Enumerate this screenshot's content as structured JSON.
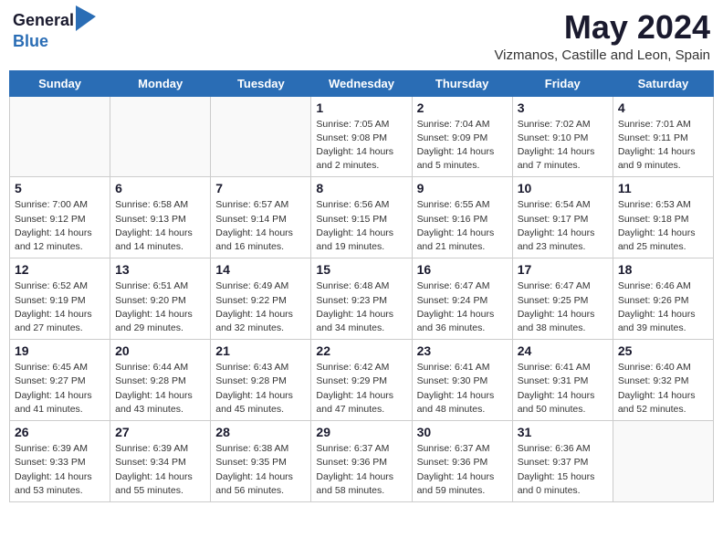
{
  "header": {
    "logo_line1": "General",
    "logo_line2": "Blue",
    "month_title": "May 2024",
    "location": "Vizmanos, Castille and Leon, Spain"
  },
  "days_of_week": [
    "Sunday",
    "Monday",
    "Tuesday",
    "Wednesday",
    "Thursday",
    "Friday",
    "Saturday"
  ],
  "weeks": [
    [
      {
        "day": "",
        "info": ""
      },
      {
        "day": "",
        "info": ""
      },
      {
        "day": "",
        "info": ""
      },
      {
        "day": "1",
        "info": "Sunrise: 7:05 AM\nSunset: 9:08 PM\nDaylight: 14 hours\nand 2 minutes."
      },
      {
        "day": "2",
        "info": "Sunrise: 7:04 AM\nSunset: 9:09 PM\nDaylight: 14 hours\nand 5 minutes."
      },
      {
        "day": "3",
        "info": "Sunrise: 7:02 AM\nSunset: 9:10 PM\nDaylight: 14 hours\nand 7 minutes."
      },
      {
        "day": "4",
        "info": "Sunrise: 7:01 AM\nSunset: 9:11 PM\nDaylight: 14 hours\nand 9 minutes."
      }
    ],
    [
      {
        "day": "5",
        "info": "Sunrise: 7:00 AM\nSunset: 9:12 PM\nDaylight: 14 hours\nand 12 minutes."
      },
      {
        "day": "6",
        "info": "Sunrise: 6:58 AM\nSunset: 9:13 PM\nDaylight: 14 hours\nand 14 minutes."
      },
      {
        "day": "7",
        "info": "Sunrise: 6:57 AM\nSunset: 9:14 PM\nDaylight: 14 hours\nand 16 minutes."
      },
      {
        "day": "8",
        "info": "Sunrise: 6:56 AM\nSunset: 9:15 PM\nDaylight: 14 hours\nand 19 minutes."
      },
      {
        "day": "9",
        "info": "Sunrise: 6:55 AM\nSunset: 9:16 PM\nDaylight: 14 hours\nand 21 minutes."
      },
      {
        "day": "10",
        "info": "Sunrise: 6:54 AM\nSunset: 9:17 PM\nDaylight: 14 hours\nand 23 minutes."
      },
      {
        "day": "11",
        "info": "Sunrise: 6:53 AM\nSunset: 9:18 PM\nDaylight: 14 hours\nand 25 minutes."
      }
    ],
    [
      {
        "day": "12",
        "info": "Sunrise: 6:52 AM\nSunset: 9:19 PM\nDaylight: 14 hours\nand 27 minutes."
      },
      {
        "day": "13",
        "info": "Sunrise: 6:51 AM\nSunset: 9:20 PM\nDaylight: 14 hours\nand 29 minutes."
      },
      {
        "day": "14",
        "info": "Sunrise: 6:49 AM\nSunset: 9:22 PM\nDaylight: 14 hours\nand 32 minutes."
      },
      {
        "day": "15",
        "info": "Sunrise: 6:48 AM\nSunset: 9:23 PM\nDaylight: 14 hours\nand 34 minutes."
      },
      {
        "day": "16",
        "info": "Sunrise: 6:47 AM\nSunset: 9:24 PM\nDaylight: 14 hours\nand 36 minutes."
      },
      {
        "day": "17",
        "info": "Sunrise: 6:47 AM\nSunset: 9:25 PM\nDaylight: 14 hours\nand 38 minutes."
      },
      {
        "day": "18",
        "info": "Sunrise: 6:46 AM\nSunset: 9:26 PM\nDaylight: 14 hours\nand 39 minutes."
      }
    ],
    [
      {
        "day": "19",
        "info": "Sunrise: 6:45 AM\nSunset: 9:27 PM\nDaylight: 14 hours\nand 41 minutes."
      },
      {
        "day": "20",
        "info": "Sunrise: 6:44 AM\nSunset: 9:28 PM\nDaylight: 14 hours\nand 43 minutes."
      },
      {
        "day": "21",
        "info": "Sunrise: 6:43 AM\nSunset: 9:28 PM\nDaylight: 14 hours\nand 45 minutes."
      },
      {
        "day": "22",
        "info": "Sunrise: 6:42 AM\nSunset: 9:29 PM\nDaylight: 14 hours\nand 47 minutes."
      },
      {
        "day": "23",
        "info": "Sunrise: 6:41 AM\nSunset: 9:30 PM\nDaylight: 14 hours\nand 48 minutes."
      },
      {
        "day": "24",
        "info": "Sunrise: 6:41 AM\nSunset: 9:31 PM\nDaylight: 14 hours\nand 50 minutes."
      },
      {
        "day": "25",
        "info": "Sunrise: 6:40 AM\nSunset: 9:32 PM\nDaylight: 14 hours\nand 52 minutes."
      }
    ],
    [
      {
        "day": "26",
        "info": "Sunrise: 6:39 AM\nSunset: 9:33 PM\nDaylight: 14 hours\nand 53 minutes."
      },
      {
        "day": "27",
        "info": "Sunrise: 6:39 AM\nSunset: 9:34 PM\nDaylight: 14 hours\nand 55 minutes."
      },
      {
        "day": "28",
        "info": "Sunrise: 6:38 AM\nSunset: 9:35 PM\nDaylight: 14 hours\nand 56 minutes."
      },
      {
        "day": "29",
        "info": "Sunrise: 6:37 AM\nSunset: 9:36 PM\nDaylight: 14 hours\nand 58 minutes."
      },
      {
        "day": "30",
        "info": "Sunrise: 6:37 AM\nSunset: 9:36 PM\nDaylight: 14 hours\nand 59 minutes."
      },
      {
        "day": "31",
        "info": "Sunrise: 6:36 AM\nSunset: 9:37 PM\nDaylight: 15 hours\nand 0 minutes."
      },
      {
        "day": "",
        "info": ""
      }
    ]
  ]
}
